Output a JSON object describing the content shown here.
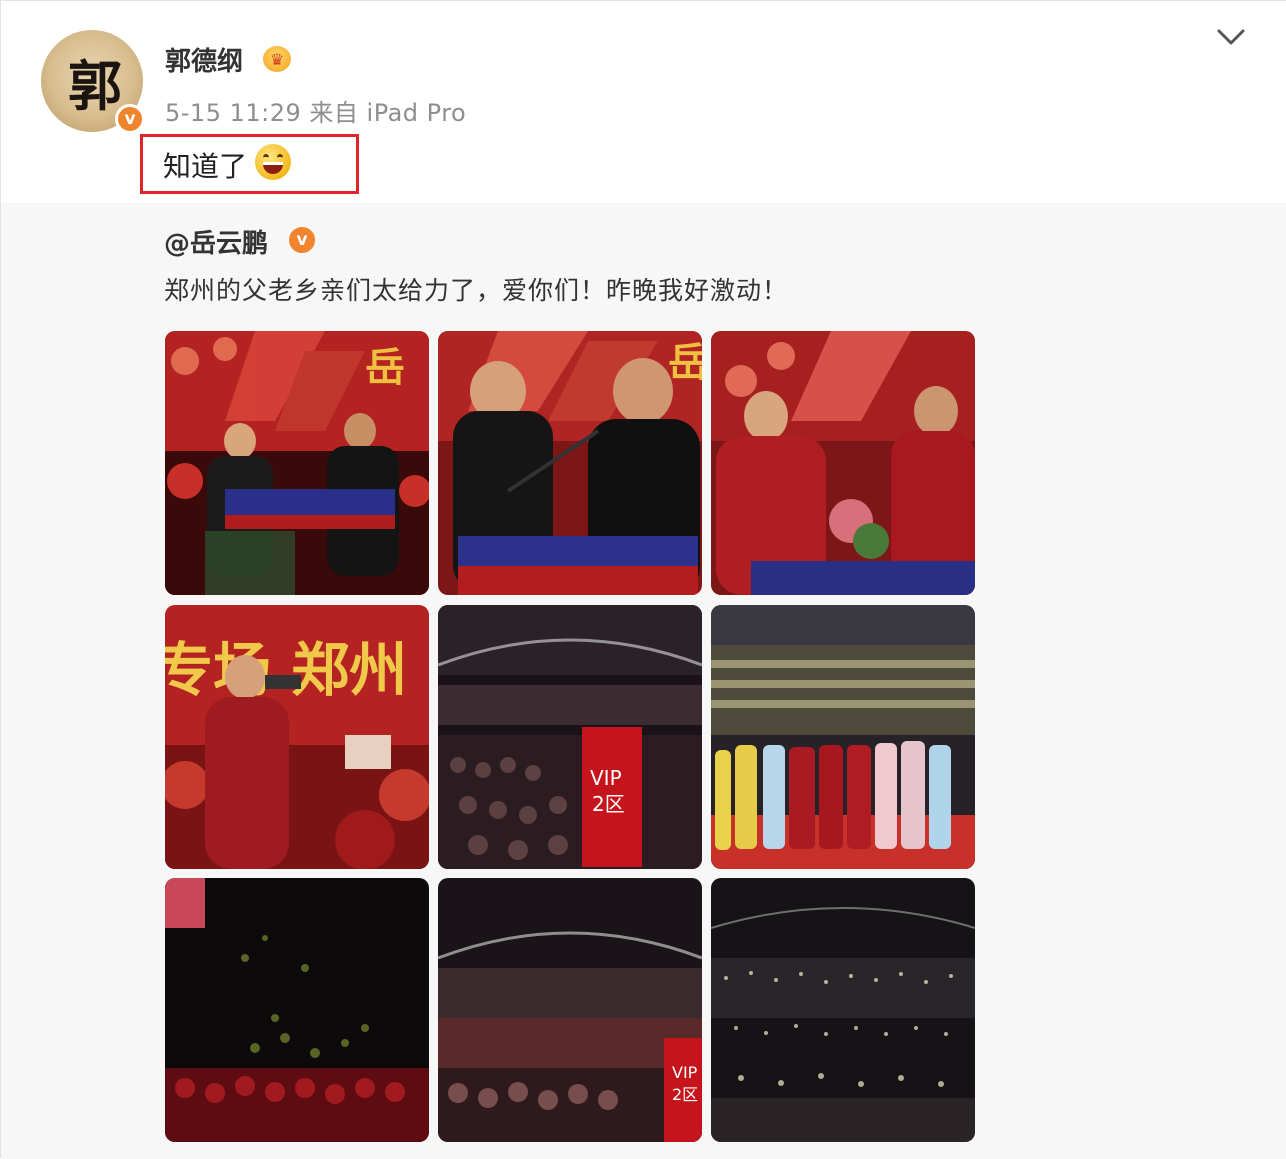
{
  "post": {
    "author": "郭德纲",
    "timestamp": "5-15 11:29",
    "source": "来自 iPad Pro",
    "text": "知道了"
  },
  "repost": {
    "author": "@岳云鹏",
    "text": "郑州的父老乡亲们太给力了，爱你们！昨晚我好激动！"
  },
  "photo_texts": {
    "stage_banner_1": "岳",
    "stage_banner_2": "岳",
    "selfie_banner": "专场 郑州",
    "vip_sign_1": "VIP",
    "vip_sign_1b": "2区",
    "vip_sign_2": "VIP",
    "vip_sign_2b": "2区"
  },
  "icons": {
    "verified": "verified-badge-icon",
    "crown": "member-crown-icon",
    "menu": "chevron-down-icon",
    "emoji": "laughing-emoji-icon"
  },
  "colors": {
    "verified_orange": "#f0852d",
    "highlight_red": "#e0242b",
    "repost_bg": "#f7f7f8",
    "meta_gray": "#8e8e8e"
  }
}
